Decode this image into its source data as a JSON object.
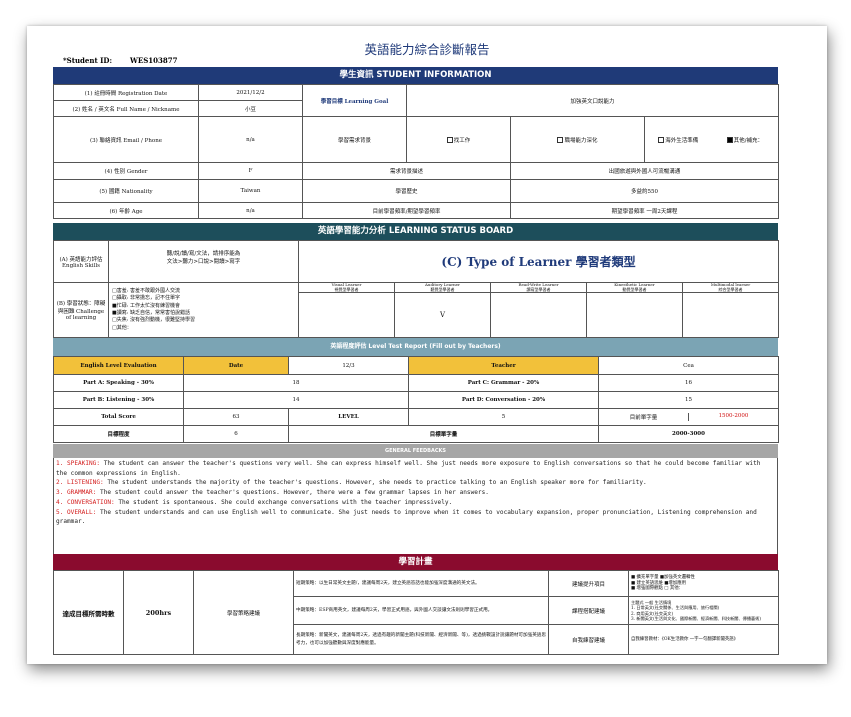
{
  "doc_title": "英語能力綜合診斷報告",
  "student": {
    "label": "*Student ID:",
    "value": "WES103877"
  },
  "sections": {
    "info": "學生資訊 STUDENT INFORMATION",
    "status": "英語學習能力分析 LEARNING STATUS BOARD",
    "level": "英語程度評估          Level Test Report  (Fill out by Teachers)",
    "feedback": "GENERAL FEEDBACKS",
    "plan": "學習計畫"
  },
  "info": {
    "reg_label": "(1) 註冊時間 Registration Date",
    "reg_value": "2021/12/2",
    "goal_label": "學習目標 Learning Goal",
    "goal_value": "加強英文口說能力",
    "name_label": "(2) 姓名 / 英文名 Full Name / Nickname",
    "name_value": "小豆",
    "contact_label": "(3) 聯絡資訊 Email / Phone",
    "contact_value": "n/a",
    "bg_label": "學習需求背景",
    "bg_options": [
      {
        "label": "找工作",
        "checked": false
      },
      {
        "label": "職場能力深化",
        "checked": false
      },
      {
        "label": "海外生活準備",
        "checked": false
      },
      {
        "label": "其他/補充：",
        "checked": true
      }
    ],
    "gender_label": "(4) 性別 Gender",
    "gender_value": "F",
    "needs_label": "需求背景描述",
    "needs_value": "出國旅遊與外國人可流暢溝通",
    "nation_label": "(5) 國籍 Nationality",
    "nation_value": "Taiwan",
    "history_label": "學習歷史",
    "history_value": "多益約550",
    "age_label": "(6) 年齡 Age",
    "age_value": "n/a",
    "freq_label": "目前學習頻率/期望學習頻率",
    "freq_value": "期望學習頻率 一周2天課程"
  },
  "status": {
    "skills_label": "(A) 英語能力評估 English Skills",
    "skills_text_1": "聽/說/讀/寫/文法，請排序能為",
    "skills_text_2": "文法>聽力>口說>閱讀>寫字",
    "type_title": "(C) Type of Learner 學習者類型",
    "learner_types": [
      {
        "en": "Visual Learner",
        "zh": "視覺型學習者",
        "mark": ""
      },
      {
        "en": "Auditory Learner",
        "zh": "聽覺型學習者",
        "mark": "V"
      },
      {
        "en": "Read-Write Learner",
        "zh": "讀寫型學習者",
        "mark": ""
      },
      {
        "en": "Kinesthetic Learner",
        "zh": "動覺型學習者",
        "mark": ""
      },
      {
        "en": "Multimodal learner",
        "zh": "綜合型學習者",
        "mark": ""
      }
    ],
    "challenge_label": "(B) 學習狀態：障礙與困難 Challenge of learning",
    "challenges": [
      "□害羞: 害羞不敢跟外國人交流",
      "□攝取: 非常擔忘，記不住單字",
      "■忙碌: 工作太忙沒有練習機會",
      "■讀寫: 缺乏自信，常常害怕說錯話",
      "□失焦: 沒有強烈動機，很難堅持學習",
      "□其他："
    ]
  },
  "level": {
    "eval_label": "English Level Evaluation",
    "date_label": "Date",
    "date_value": "12/3",
    "teacher_label": "Teacher",
    "teacher_value": "Cea",
    "speaking_label": "Part A: Speaking - 30%",
    "speaking_value": "18",
    "grammar_label": "Part C: Grammar - 20%",
    "grammar_value": "16",
    "listening_label": "Part B: Listening - 30%",
    "listening_value": "14",
    "conversation_label": "Part D: Conversation - 20%",
    "conversation_value": "15",
    "total_label": "Total Score",
    "total_value": "63",
    "level_label": "LEVEL",
    "level_value": "5",
    "vocab_label": "目前單字量",
    "vocab_value": "1500-2000",
    "target_label": "目標程度",
    "target_value": "6",
    "target_vocab_label": "目標單字量",
    "target_vocab_value": "2000-3000"
  },
  "feedback": [
    {
      "label": "1. SPEAKING:",
      "text": " The student can answer the teacher's questions very well. She can express himself well. She just needs more exposure to English conversations so that he could become familiar with the common expressions in English."
    },
    {
      "label": "2. LISTENING:",
      "text": " The student understands the majority of the teacher's questions. However, she needs to practice talking to an English speaker more for familiarity."
    },
    {
      "label": "3. GRAMMAR:",
      "text": " The student could answer the teacher's questions. However, there were a few grammar lapses in her answers."
    },
    {
      "label": "4. CONVERSATION:",
      "text": " The student is spontaneous. She could exchange conversations with the teacher impressively."
    },
    {
      "label": "5. OVERALL:",
      "text": " The student understands and can use English well to communicate. She just needs to improve when it comes to vocabulary expansion, proper pronunciation, Listening comprehension and grammar."
    }
  ],
  "plan": {
    "goal_label": "達成目標所需時數",
    "hours": "200hrs",
    "strategy_label": "學習策略建議",
    "short_term": "短期策略：以生日常英文主題/，建議每周2天，建立英語答話也能加強深度溝通的英文法。",
    "mid_term": "中期策略：ESP商用英文，建議每周2天，學習正式用語，與外國人交談讓文法則則學習正式用。",
    "long_term": "長期策略：新聞英文，建議每周2天，透過有趣的新聞主題(科技新聞、經濟新聞、等)，透過挑戰設計說讓題材可加強英語思考力，也可以加強聽數與深度對應能量。",
    "suggest_label": "建議提升項目",
    "suggest_items": [
      "■ 擴充單字量  ■加強英文邏輯性",
      "■ 建立英語思維 ■增加應用",
      "■ 增強國際觀點 □ 其他："
    ],
    "material_label": "課程搭配建議",
    "materials": [
      "主題式 一般 生活情境",
      "1. 日常英文(社交關係、生活與應用、旅行相關)",
      "2. 商用英文(社交英文)",
      "3. 新聞英文(生活與文化、國際新聞、經濟新聞、科技新聞、傳播藝術)"
    ],
    "self_label": "自我練習建議",
    "self_value": "自我練習教材：《OK生活教你 一字一句翻譯新聞英語》"
  }
}
